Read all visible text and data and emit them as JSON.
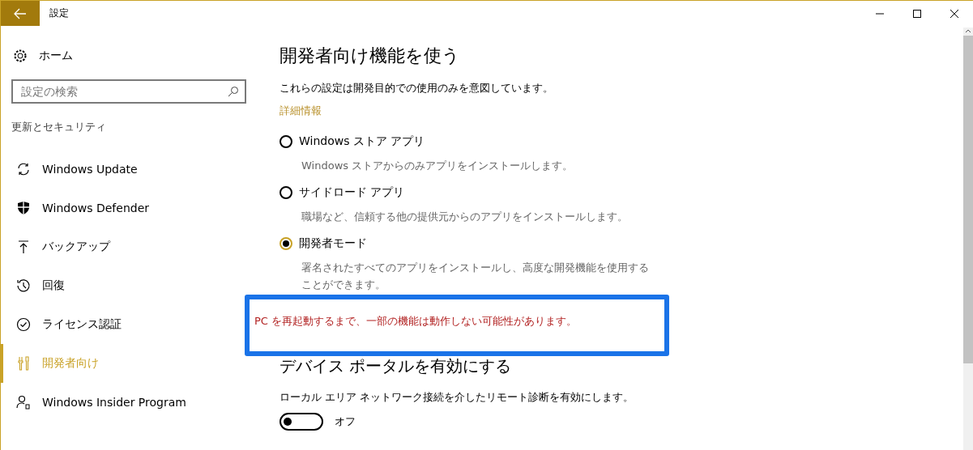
{
  "window": {
    "title": "設定"
  },
  "sidebar": {
    "home": "ホーム",
    "search": {
      "placeholder": "設定の検索"
    },
    "section": "更新とセキュリティ",
    "items": [
      {
        "kind": "sync",
        "label": "Windows Update",
        "selected": false
      },
      {
        "kind": "shield",
        "label": "Windows Defender",
        "selected": false
      },
      {
        "kind": "backup",
        "label": "バックアップ",
        "selected": false
      },
      {
        "kind": "history",
        "label": "回復",
        "selected": false
      },
      {
        "kind": "check",
        "label": "ライセンス認証",
        "selected": false
      },
      {
        "kind": "tools",
        "label": "開発者向け",
        "selected": true
      },
      {
        "kind": "insider",
        "label": "Windows Insider Program",
        "selected": false
      }
    ]
  },
  "content": {
    "title": "開発者向け機能を使う",
    "description": "これらの設定は開発目的での使用のみを意図しています。",
    "link": "詳細情報",
    "options": [
      {
        "label": "Windows ストア アプリ",
        "detail": "Windows ストアからのみアプリをインストールします。",
        "selected": false
      },
      {
        "label": "サイドロード アプリ",
        "detail": "職場など、信頼する他の提供元からのアプリをインストールします。",
        "selected": false
      },
      {
        "label": "開発者モード",
        "detail": "署名されたすべてのアプリをインストールし、高度な開発機能を使用することができます。",
        "selected": true
      }
    ],
    "warning": "PC を再起動するまで、一部の機能は動作しない可能性があります。",
    "portal": {
      "title": "デバイス ポータルを有効にする",
      "description": "ローカル エリア ネットワーク接続を介したリモート診断を有効にします。",
      "toggle": {
        "on": false,
        "label": "オフ"
      }
    }
  }
}
